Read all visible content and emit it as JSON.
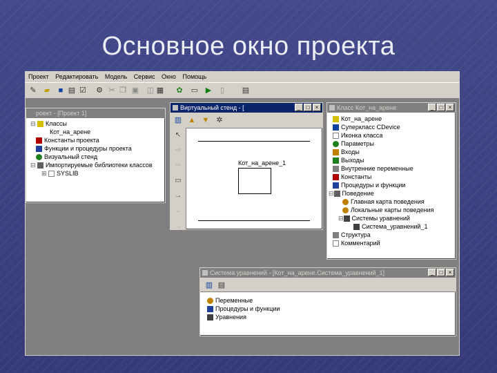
{
  "slide": {
    "title": "Основное окно проекта"
  },
  "app": {
    "menu": [
      "Проект",
      "Редактировать",
      "Модель",
      "Сервис",
      "Окно",
      "Помощь"
    ],
    "toolbar_icons": [
      "new-icon",
      "open-icon",
      "save-icon",
      "properties-icon",
      "edit-icon",
      "settings-icon",
      "cut-icon",
      "copy-icon",
      "paste-icon",
      "check-icon",
      "build-icon",
      "run-icon",
      "play-icon",
      "pause-icon",
      "calculator-icon"
    ]
  },
  "project_window": {
    "title": "роект - [Проект 1]",
    "items": [
      {
        "label": "Классы",
        "icon": "folder-icon",
        "color": "#d4c000",
        "level": 0
      },
      {
        "label": "Кот_на_арене",
        "icon": "",
        "color": "",
        "level": 1
      },
      {
        "label": "Константы проекта",
        "icon": "c-icon",
        "color": "#b00000",
        "level": 0
      },
      {
        "label": "Функции и процедуры проекта",
        "icon": "f-icon",
        "color": "#2040a0",
        "level": 0
      },
      {
        "label": "Визуальный стенд",
        "icon": "stand-icon",
        "color": "#208020",
        "level": 0
      },
      {
        "label": "Импортируемые библиотеки классов",
        "icon": "library-icon",
        "color": "#606060",
        "level": 0
      },
      {
        "label": "SYSLIB",
        "icon": "lib-icon",
        "color": "#808080",
        "level": 1
      }
    ]
  },
  "stand_window": {
    "title": "Виртуальный стенд - [",
    "object_label": "Кот_на_арене_1"
  },
  "class_window": {
    "title": "Класс Кот_на_арене",
    "items": [
      {
        "label": "Кот_на_арене",
        "level": 0,
        "color": "#d4c000"
      },
      {
        "label": "Суперкласс CDevice",
        "level": 0,
        "color": "#1040a0"
      },
      {
        "label": "Иконка класса",
        "level": 0,
        "color": "#808080"
      },
      {
        "label": "Параметры",
        "level": 0,
        "color": "#208020"
      },
      {
        "label": "Входы",
        "level": 0,
        "color": "#c08000"
      },
      {
        "label": "Выходы",
        "level": 0,
        "color": "#208020"
      },
      {
        "label": "Внутренние переменные",
        "level": 0,
        "color": "#808080"
      },
      {
        "label": "Константы",
        "level": 0,
        "color": "#b00000"
      },
      {
        "label": "Процедуры и функции",
        "level": 0,
        "color": "#2040a0"
      },
      {
        "label": "Поведение",
        "level": 0,
        "color": "#606060"
      },
      {
        "label": "Главная карта поведения",
        "level": 1,
        "color": "#c08000"
      },
      {
        "label": "Локальные карты поведения",
        "level": 1,
        "color": "#c08000"
      },
      {
        "label": "Системы уравнений",
        "level": 1,
        "color": "#404040"
      },
      {
        "label": "Система_уравнений_1",
        "level": 2,
        "color": "#404040"
      },
      {
        "label": "Структура",
        "level": 0,
        "color": "#808080"
      },
      {
        "label": "Комментарий",
        "level": 0,
        "color": "#808080"
      }
    ]
  },
  "equation_window": {
    "title": "Система уравнений - [Кот_на_арене.Система_уравнений_1]",
    "items": [
      {
        "label": "Переменные",
        "color": "#c08000"
      },
      {
        "label": "Процедуры и функции",
        "color": "#2040a0"
      },
      {
        "label": "Уравнения",
        "color": "#404040"
      }
    ]
  }
}
